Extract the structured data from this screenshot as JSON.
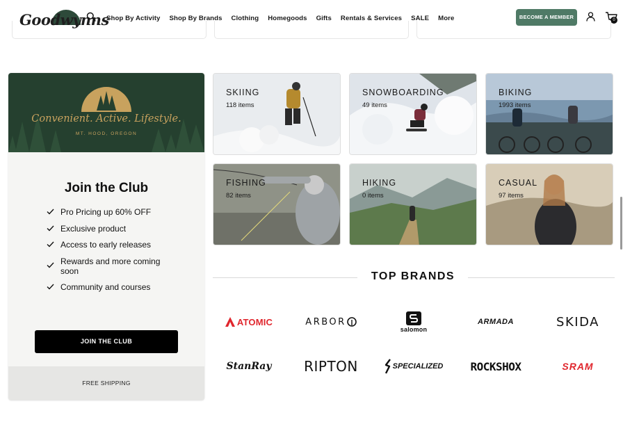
{
  "header": {
    "logo_text": "Goodwynns",
    "nav": [
      "Shop By Activity",
      "Shop By Brands",
      "Clothing",
      "Homegoods",
      "Gifts",
      "Rentals & Services",
      "SALE",
      "More"
    ],
    "member_button": "BECOME A MEMBER",
    "cart_count": "0",
    "icons": [
      "search-icon",
      "user-icon",
      "cart-icon"
    ]
  },
  "club": {
    "tagline": "Convenient. Active. Lifestyle.",
    "location": "MT. HOOD, OREGON",
    "title": "Join the Club",
    "perks": [
      "Pro Pricing up 60% OFF",
      "Exclusive product",
      "Access to early releases",
      "Rewards and more coming soon",
      "Community and courses"
    ],
    "join_button": "JOIN THE CLUB",
    "shipping": "FREE SHIPPING"
  },
  "activities": [
    {
      "name": "SKIING",
      "count": "118 items"
    },
    {
      "name": "SNOWBOARDING",
      "count": "49 items"
    },
    {
      "name": "BIKING",
      "count": "1993 items"
    },
    {
      "name": "FISHING",
      "count": "82 items"
    },
    {
      "name": "HIKING",
      "count": "0 items"
    },
    {
      "name": "CASUAL",
      "count": "97 items"
    }
  ],
  "brands": {
    "title": "TOP BRANDS",
    "items": [
      "ATOMIC",
      "ARBOR",
      "salomon",
      "ARMADA",
      "SKIDA",
      "StanRay",
      "RIPTON",
      "SPECIALIZED",
      "ROCKSHOX",
      "SRAM"
    ]
  },
  "colors": {
    "brand_green": "#25402f",
    "accent_gold": "#c8a25e",
    "member_button": "#4f7a66",
    "brand_red": "#e0262d"
  }
}
